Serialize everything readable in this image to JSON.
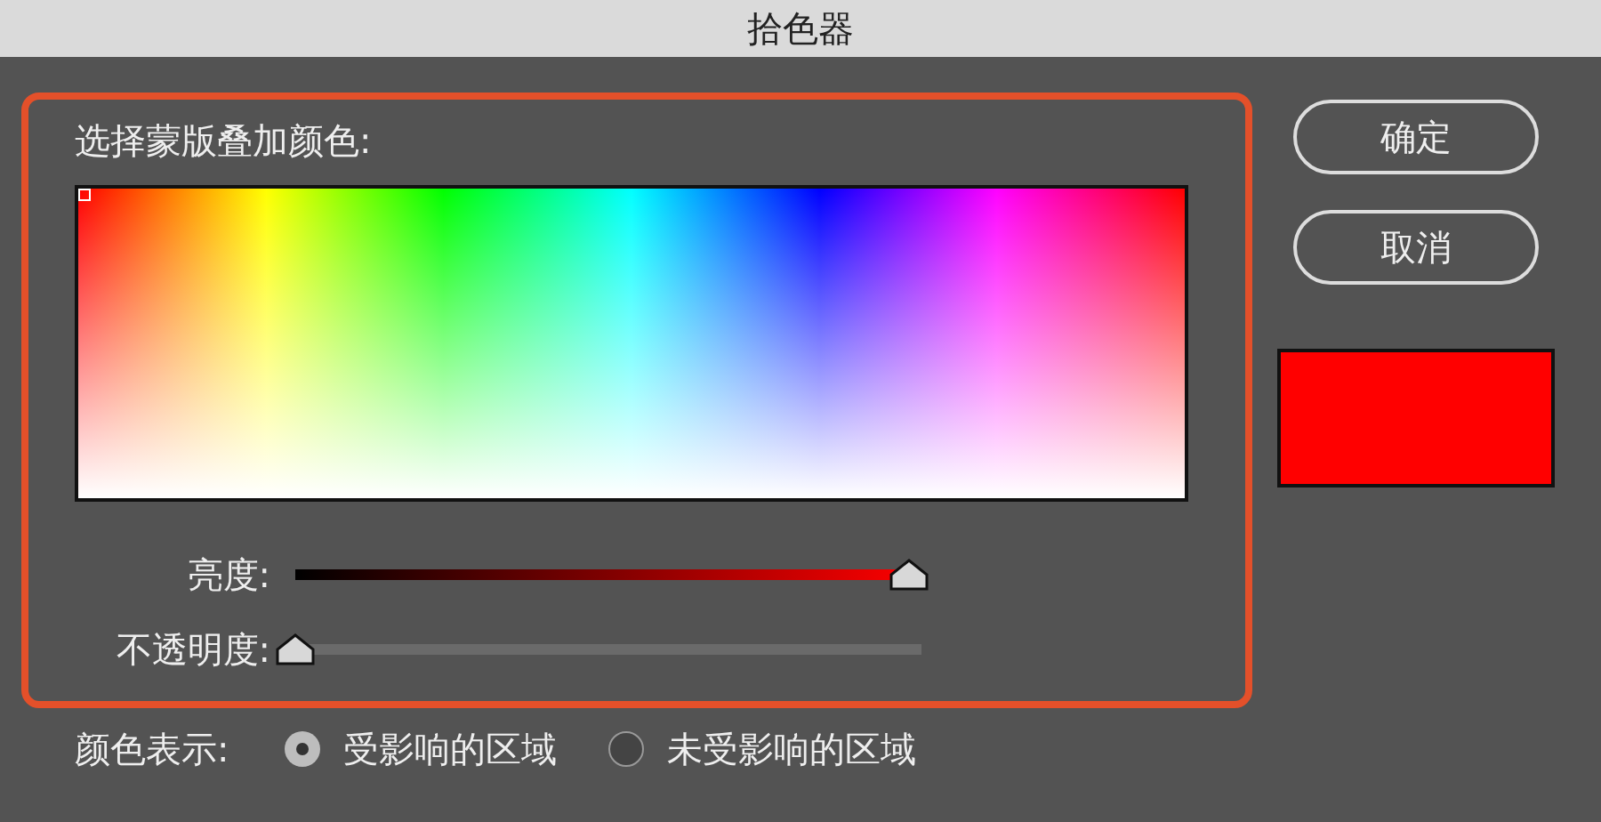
{
  "window": {
    "title": "拾色器"
  },
  "picker": {
    "label": "选择蒙版叠加颜色:"
  },
  "sliders": [
    {
      "label": "亮度:",
      "kind": "brightness",
      "level": 0.98
    },
    {
      "label": "不透明度:",
      "kind": "opacity",
      "level": 0
    }
  ],
  "buttons": [
    {
      "label": "确定"
    },
    {
      "label": "取消"
    }
  ],
  "swatch": {
    "color": "#ff0000"
  },
  "color_display": {
    "label": "颜色表示:",
    "options": [
      {
        "label": "受影响的区域",
        "selected": true
      },
      {
        "label": "未受影响的区域",
        "selected": false
      }
    ]
  }
}
